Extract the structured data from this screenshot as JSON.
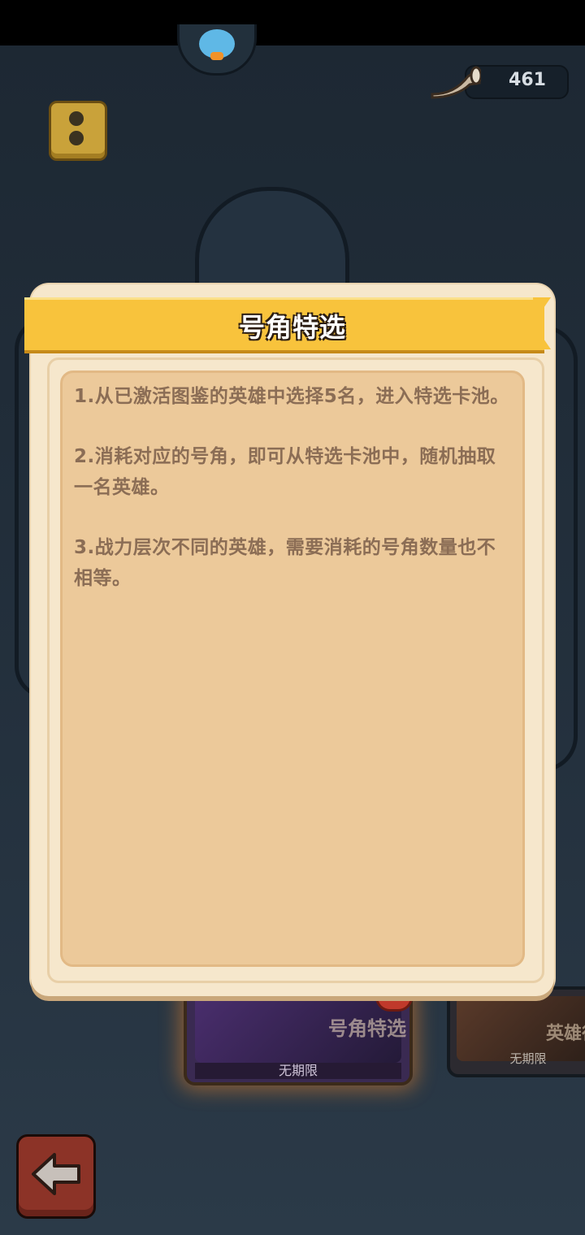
{
  "top": {
    "currency_value": "461"
  },
  "cards": [
    {
      "title": "号角特选",
      "subtitle": "无期限"
    },
    {
      "title": "英雄征",
      "subtitle": "无期限"
    }
  ],
  "modal": {
    "title": "号角特选",
    "rules": [
      "1.从已激活图鉴的英雄中选择5名，进入特选卡池。",
      "2.消耗对应的号角，即可从特选卡池中，随机抽取一名英雄。",
      "3.战力层次不同的英雄，需要消耗的号角数量也不相等。"
    ]
  },
  "icons": {
    "info": "info-icon",
    "back": "back-arrow-icon",
    "currency": "horn-icon"
  },
  "colors": {
    "ribbon": "#f8c33c",
    "panel": "#ecc99a",
    "rule_text": "#8b6d55"
  }
}
